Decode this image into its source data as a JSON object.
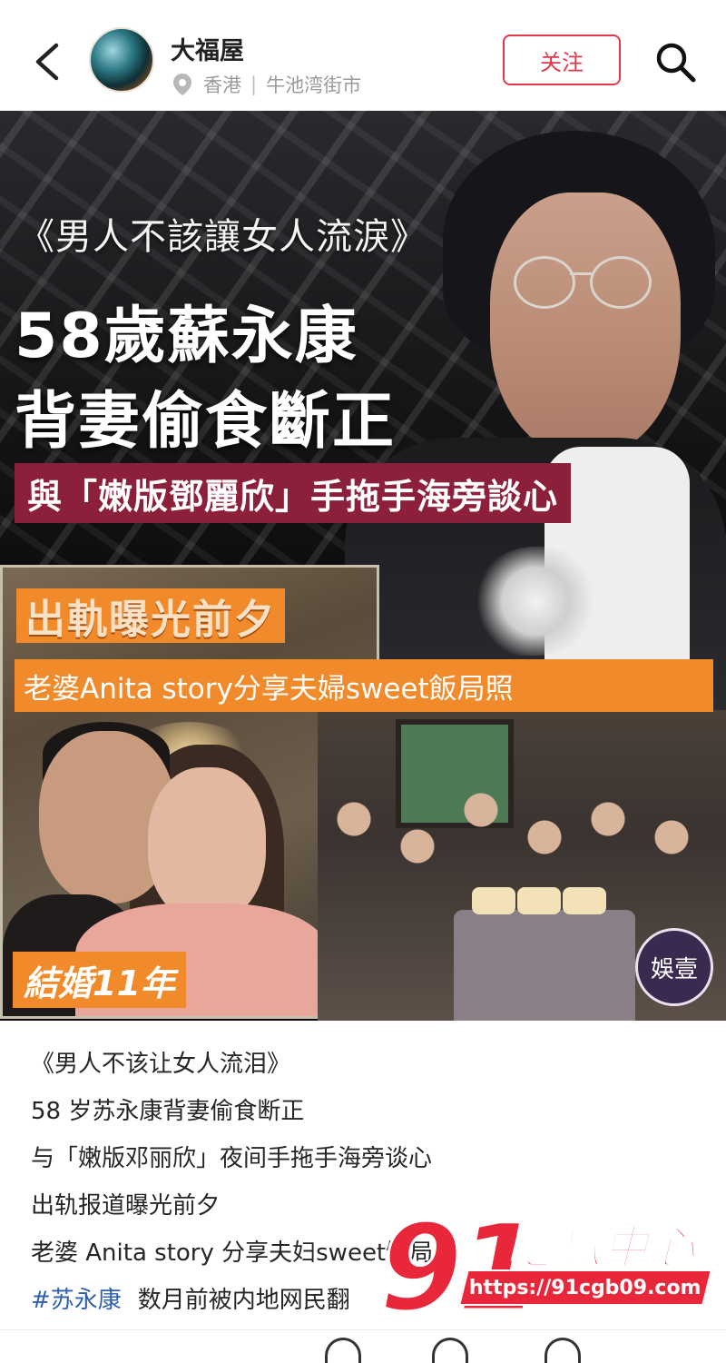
{
  "header": {
    "username": "大福屋",
    "location_region": "香港",
    "location_separator": "|",
    "location_place": "牛池湾街市",
    "follow_label": "关注"
  },
  "poster": {
    "quote_title": "《男人不該讓女人流淚》",
    "headline_1": "58歲蘇永康",
    "headline_2": "背妻偷食斷正",
    "subheadline": "與「嫩版鄧麗欣」手拖手海旁談心",
    "tag_1": "出軌曝光前夕",
    "tag_2": "老婆Anita story分享夫婦sweet飯局照",
    "married_label": "結婚11年",
    "badge_text": "娛壹"
  },
  "caption": {
    "lines": [
      "《男人不该让女人流泪》",
      "58 岁苏永康背妻偷食断正",
      "与「嫩版邓丽欣」夜间手拖手海旁谈心",
      "出轨报道曝光前夕",
      "老婆 Anita story 分享夫妇sweet饭局照"
    ],
    "hashtag": "#苏永康",
    "last_line": "数月前被内地网民翻"
  },
  "watermark": {
    "number": "91",
    "name": "吃瓜中心",
    "url": "https://91cgb09.com"
  },
  "colors": {
    "accent": "#e2364b",
    "poster_band": "#8c1f3a",
    "orange": "#f08a2a",
    "hashtag": "#2f5fb3",
    "watermark_red": "#e8283a"
  },
  "icons": {
    "back": "chevron-left-icon",
    "location": "map-pin-icon",
    "search": "search-icon"
  }
}
